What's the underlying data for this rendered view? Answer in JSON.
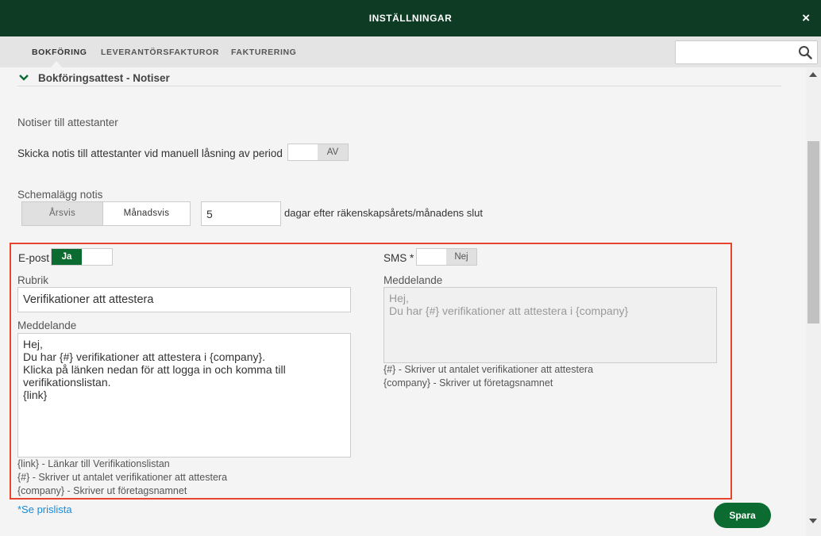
{
  "header": {
    "title": "INSTÄLLNINGAR",
    "close": "×"
  },
  "tabs": [
    {
      "label": "BOKFÖRING",
      "active": true
    },
    {
      "label": "LEVERANTÖRSFAKTUROR",
      "active": false
    },
    {
      "label": "FAKTURERING",
      "active": false
    }
  ],
  "search": {
    "value": "",
    "placeholder": ""
  },
  "section": {
    "title": "Bokföringsattest - Notiser"
  },
  "notices": {
    "heading": "Notiser till attestanter",
    "manual_lock_label": "Skicka notis till attestanter vid manuell låsning av period",
    "manual_lock_toggle": "AV"
  },
  "schedule": {
    "label": "Schemalägg notis",
    "options": [
      "Årsvis",
      "Månadsvis"
    ],
    "selected": "Månadsvis",
    "days_value": "5",
    "days_suffix": "dagar efter räkenskapsårets/månadens slut"
  },
  "email": {
    "label": "E-post",
    "toggle": "Ja",
    "subject_label": "Rubrik",
    "subject_value": "Verifikationer att attestera",
    "message_label": "Meddelande",
    "message_value": "Hej,\nDu har {#} verifikationer att attestera i {company}.\nKlicka på länken nedan för att logga in och komma till verifikationslistan.\n{link}",
    "help": [
      "{link} - Länkar till Verifikationslistan",
      "{#} - Skriver ut antalet verifikationer att attestera",
      "{company} - Skriver ut företagsnamnet"
    ]
  },
  "sms": {
    "label": "SMS *",
    "toggle": "Nej",
    "message_label": "Meddelande",
    "message_value": "Hej,\nDu har {#} verifikationer att attestera i {company}",
    "help": [
      "{#} - Skriver ut antalet verifikationer att attestera",
      "{company} - Skriver ut företagsnamnet"
    ]
  },
  "price_link": "*Se prislista",
  "save_label": "Spara",
  "colors": {
    "header": "#0e3b23",
    "accent": "#0c6b30",
    "highlight": "#e8452f",
    "link": "#1a8ad6"
  }
}
